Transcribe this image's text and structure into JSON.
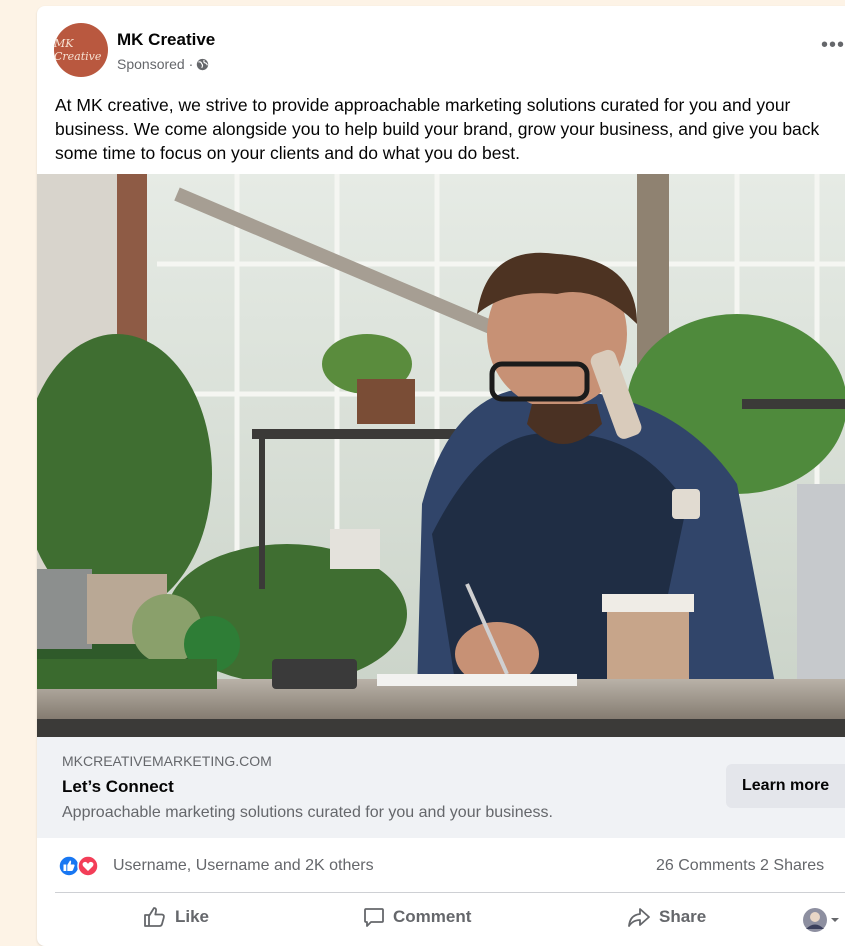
{
  "post": {
    "page_name": "MK Creative",
    "avatar_text": "MK Creative",
    "sponsored_label": "Sponsored ·",
    "body_text": "At MK creative, we strive to provide approachable marketing solutions curated for you and your business. We come alongside you to help build your brand, grow your business, and give you back some time to focus on your clients and do what you do best."
  },
  "link": {
    "domain": "MKCREATIVEMARKETING.COM",
    "headline": "Let’s Connect",
    "description": "Approachable marketing solutions curated for you and your business.",
    "cta_label": "Learn more"
  },
  "stats": {
    "reaction_names": "Username, Username and 2K others",
    "comments": "26 Comments",
    "shares": "2 Shares"
  },
  "actions": {
    "like": "Like",
    "comment": "Comment",
    "share": "Share"
  },
  "icons": {
    "globe": "globe-icon",
    "more": "more-icon",
    "like_reaction": "like-reaction-icon",
    "love_reaction": "love-reaction-icon",
    "like": "thumbs-up-icon",
    "comment": "comment-bubble-icon",
    "share": "share-arrow-icon",
    "viewer_avatar": "viewer-avatar",
    "dropdown": "caret-down-icon"
  },
  "colors": {
    "page_background": "#fdf3e6",
    "avatar": "#b9583f",
    "like_blue": "#1877f2",
    "love_red": "#f33e58",
    "link_bar": "#f0f2f5",
    "cta": "#e4e6eb",
    "secondary_text": "#65676b"
  }
}
